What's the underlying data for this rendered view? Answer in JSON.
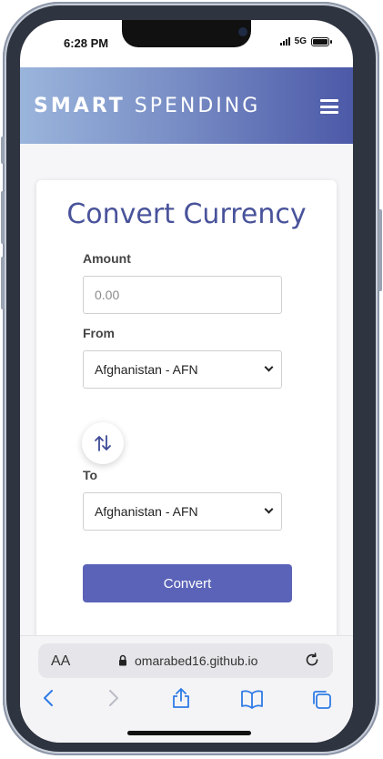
{
  "status": {
    "time": "6:28 PM",
    "network": "5G"
  },
  "header": {
    "brand_bold": "SMART",
    "brand_light": "SPENDING"
  },
  "form": {
    "title": "Convert Currency",
    "amount_label": "Amount",
    "amount_placeholder": "0.00",
    "from_label": "From",
    "from_value": "Afghanistan - AFN",
    "to_label": "To",
    "to_value": "Afghanistan - AFN",
    "convert_label": "Convert"
  },
  "browser": {
    "text_size_label": "AA",
    "url": "omarabed16.github.io"
  },
  "colors": {
    "accent": "#5a63b8",
    "title": "#49539b",
    "header_start": "#9ab5dc",
    "header_end": "#4c59a8"
  },
  "icons": [
    "menu-icon",
    "swap-icon",
    "lock-icon",
    "reload-icon",
    "back-icon",
    "forward-icon",
    "share-icon",
    "bookmarks-icon",
    "tabs-icon",
    "chevron-down-icon"
  ]
}
